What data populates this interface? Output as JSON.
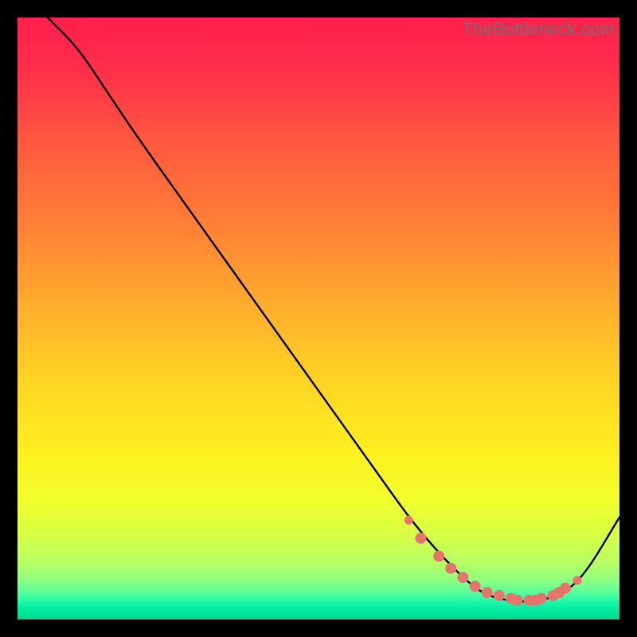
{
  "watermark": "TheBottleneck.com",
  "chart_data": {
    "type": "line",
    "title": "",
    "xlabel": "",
    "ylabel": "",
    "xlim": [
      0,
      100
    ],
    "ylim": [
      0,
      100
    ],
    "series": [
      {
        "name": "curve",
        "x": [
          5,
          10,
          14,
          20,
          30,
          40,
          50,
          60,
          65,
          70,
          75,
          78,
          82,
          86,
          90,
          94,
          100
        ],
        "y": [
          100,
          95,
          89,
          80,
          66,
          52,
          38,
          24,
          17,
          11,
          6,
          4,
          3,
          3,
          4,
          7,
          17
        ]
      }
    ],
    "highlight_dots": {
      "name": "highlight",
      "color": "#e7736d",
      "x": [
        65,
        67,
        70,
        72,
        74,
        76,
        78,
        80,
        82,
        83,
        85,
        86,
        87,
        89,
        90,
        91,
        93
      ],
      "y": [
        16.5,
        13.5,
        10.5,
        8.5,
        7,
        5.5,
        4.5,
        4,
        3.5,
        3.2,
        3.2,
        3.2,
        3.5,
        4,
        4.5,
        5.2,
        6.5
      ]
    },
    "gradient_stops": [
      {
        "offset": 0,
        "color": "#ff1f4d"
      },
      {
        "offset": 0.09,
        "color": "#ff2f4a"
      },
      {
        "offset": 0.2,
        "color": "#ff5640"
      },
      {
        "offset": 0.34,
        "color": "#ff7e36"
      },
      {
        "offset": 0.48,
        "color": "#ffad2d"
      },
      {
        "offset": 0.6,
        "color": "#ffd324"
      },
      {
        "offset": 0.72,
        "color": "#ffef20"
      },
      {
        "offset": 0.8,
        "color": "#f2ff2b"
      },
      {
        "offset": 0.86,
        "color": "#d7ff45"
      },
      {
        "offset": 0.905,
        "color": "#b8ff63"
      },
      {
        "offset": 0.935,
        "color": "#8dff81"
      },
      {
        "offset": 0.958,
        "color": "#4fffa0"
      },
      {
        "offset": 0.972,
        "color": "#18f7a8"
      },
      {
        "offset": 0.985,
        "color": "#00e8a0"
      },
      {
        "offset": 1.0,
        "color": "#00d98f"
      }
    ]
  }
}
